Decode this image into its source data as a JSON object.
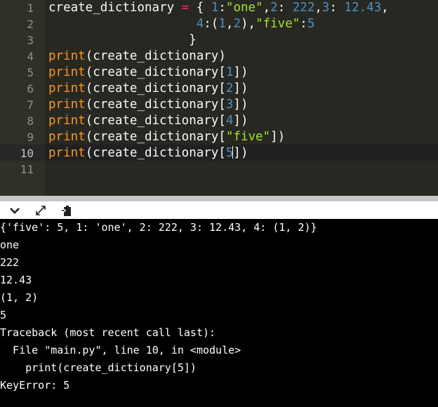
{
  "editor": {
    "line_numbers": [
      "1",
      "2",
      "3",
      "4",
      "5",
      "6",
      "7",
      "8",
      "9",
      "10",
      "11"
    ],
    "lines": [
      [
        {
          "t": "create_dictionary ",
          "c": "plain"
        },
        {
          "t": "=",
          "c": "op"
        },
        {
          "t": " { ",
          "c": "plain"
        },
        {
          "t": "1",
          "c": "num"
        },
        {
          "t": ":",
          "c": "plain"
        },
        {
          "t": "\"one\"",
          "c": "str"
        },
        {
          "t": ",",
          "c": "plain"
        },
        {
          "t": "2",
          "c": "num"
        },
        {
          "t": ": ",
          "c": "plain"
        },
        {
          "t": "222",
          "c": "num"
        },
        {
          "t": ",",
          "c": "plain"
        },
        {
          "t": "3",
          "c": "num"
        },
        {
          "t": ": ",
          "c": "plain"
        },
        {
          "t": "12.43",
          "c": "num"
        },
        {
          "t": ",",
          "c": "plain"
        }
      ],
      [
        {
          "t": "                    ",
          "c": "plain"
        },
        {
          "t": "4",
          "c": "num"
        },
        {
          "t": ":(",
          "c": "plain"
        },
        {
          "t": "1",
          "c": "num"
        },
        {
          "t": ",",
          "c": "plain"
        },
        {
          "t": "2",
          "c": "num"
        },
        {
          "t": "),",
          "c": "plain"
        },
        {
          "t": "\"five\"",
          "c": "str"
        },
        {
          "t": ":",
          "c": "plain"
        },
        {
          "t": "5",
          "c": "num"
        }
      ],
      [
        {
          "t": "                   }",
          "c": "plain"
        }
      ],
      [
        {
          "t": "print",
          "c": "fn"
        },
        {
          "t": "(create_dictionary)",
          "c": "plain"
        }
      ],
      [
        {
          "t": "print",
          "c": "fn"
        },
        {
          "t": "(create_dictionary[",
          "c": "plain"
        },
        {
          "t": "1",
          "c": "num"
        },
        {
          "t": "])",
          "c": "plain"
        }
      ],
      [
        {
          "t": "print",
          "c": "fn"
        },
        {
          "t": "(create_dictionary[",
          "c": "plain"
        },
        {
          "t": "2",
          "c": "num"
        },
        {
          "t": "])",
          "c": "plain"
        }
      ],
      [
        {
          "t": "print",
          "c": "fn"
        },
        {
          "t": "(create_dictionary[",
          "c": "plain"
        },
        {
          "t": "3",
          "c": "num"
        },
        {
          "t": "])",
          "c": "plain"
        }
      ],
      [
        {
          "t": "print",
          "c": "fn"
        },
        {
          "t": "(create_dictionary[",
          "c": "plain"
        },
        {
          "t": "4",
          "c": "num"
        },
        {
          "t": "])",
          "c": "plain"
        }
      ],
      [
        {
          "t": "print",
          "c": "fn"
        },
        {
          "t": "(create_dictionary[",
          "c": "plain"
        },
        {
          "t": "\"five\"",
          "c": "str"
        },
        {
          "t": "])",
          "c": "plain"
        }
      ],
      [
        {
          "t": "print",
          "c": "fn"
        },
        {
          "t": "(create_dictionary[",
          "c": "plain"
        },
        {
          "t": "5",
          "c": "num"
        },
        {
          "t": "CURSOR",
          "c": "cursor"
        },
        {
          "t": "])",
          "c": "plain"
        }
      ],
      []
    ],
    "active_line": "10"
  },
  "toolbar": {
    "buttons": [
      {
        "name": "chevron-down-icon"
      },
      {
        "name": "expand-icon"
      },
      {
        "name": "clipboard-icon"
      }
    ]
  },
  "console": {
    "output": [
      "{'five': 5, 1: 'one', 2: 222, 3: 12.43, 4: (1, 2)}",
      "one",
      "222",
      "12.43",
      "(1, 2)",
      "5",
      "Traceback (most recent call last):",
      "  File \"main.py\", line 10, in <module>",
      "    print(create_dictionary[5])",
      "KeyError: 5"
    ]
  }
}
